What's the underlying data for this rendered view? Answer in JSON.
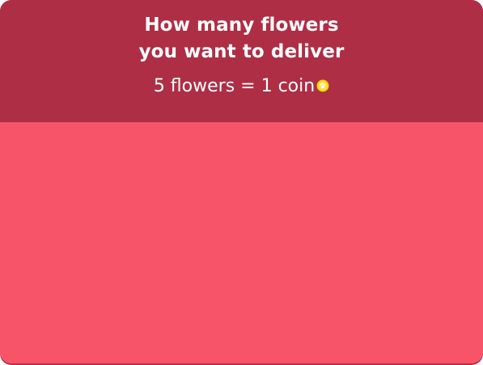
{
  "dialog": {
    "title_line1": "How many flowers",
    "title_line2": "you want to deliver",
    "rate_text": "5 flowers = 1 coin",
    "rate_icon": "coin-icon"
  },
  "colors": {
    "header_bg": "#ad2e45",
    "body_bg": "#f7546a",
    "text": "#ffffff",
    "coin_gold": "#f5d400"
  }
}
